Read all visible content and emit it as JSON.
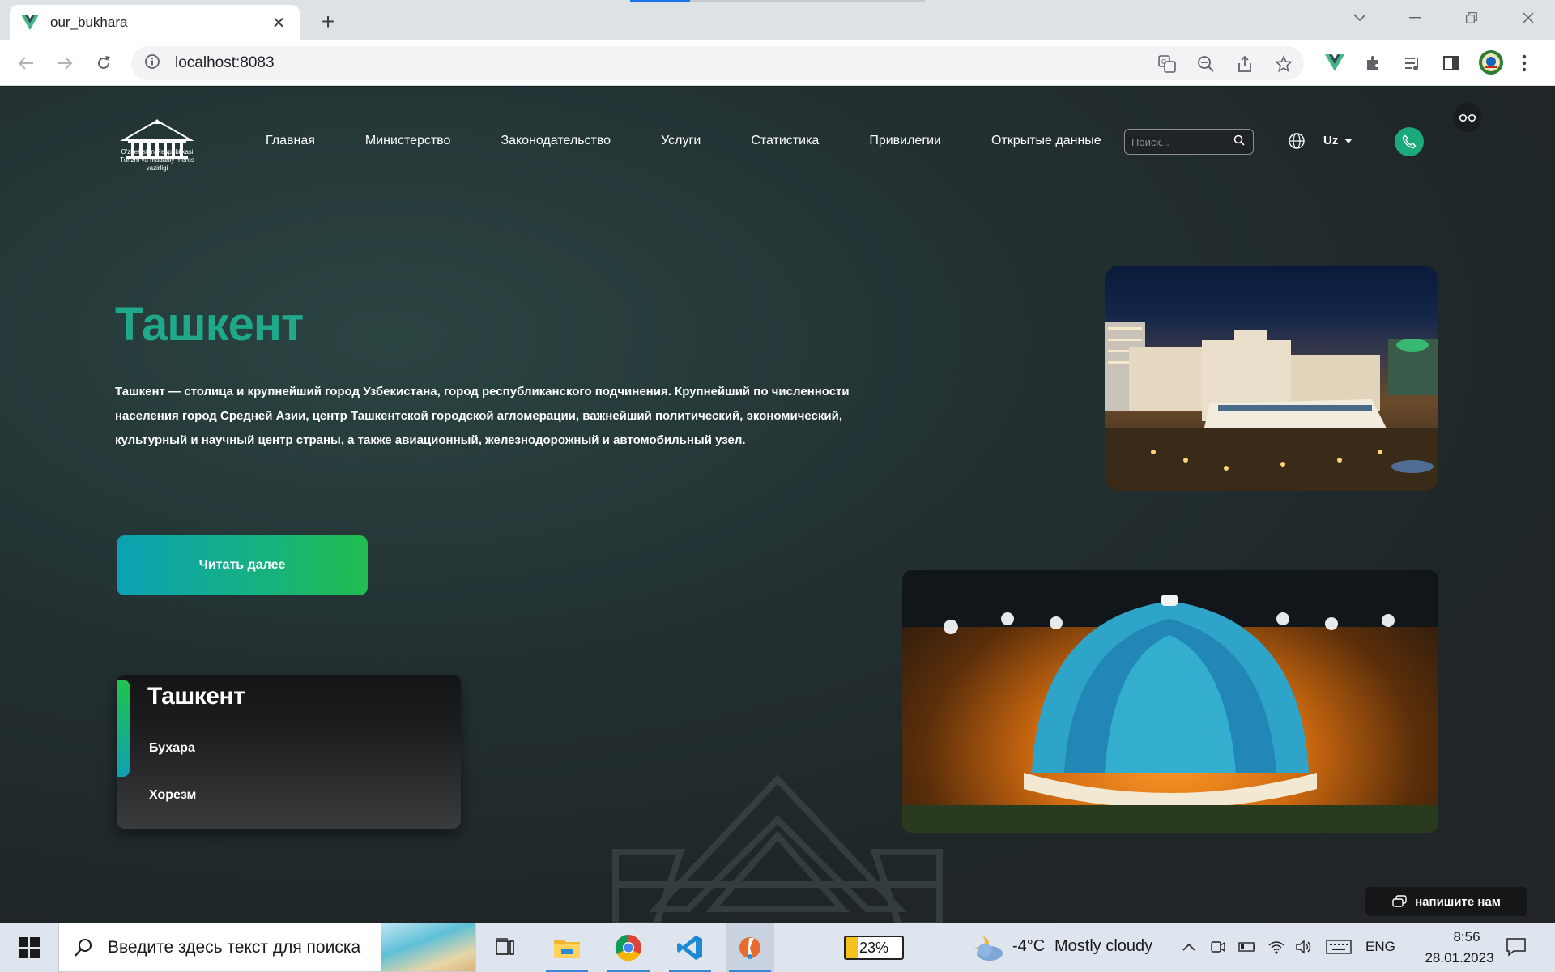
{
  "browser": {
    "tab_title": "our_bukhara",
    "new_tab_label": "+",
    "close_label": "✕",
    "url": "localhost:8083"
  },
  "site": {
    "logo_line1": "O'zbekiston Respublikasi",
    "logo_line2": "Turizm va madaniy meros",
    "logo_line3": "vazirligi",
    "menu": [
      "Главная",
      "Министерство",
      "Законодательство",
      "Услуги",
      "Статистика",
      "Привилегии",
      "Открытые данные"
    ],
    "search_placeholder": "Поиск...",
    "language": "Uz",
    "accent_color": "#1fa98a"
  },
  "hero": {
    "title": "Ташкент",
    "description": "Ташкент — столица и крупнейший город Узбекистана, город республиканского подчинения. Крупнейший по численности населения город Средней Азии, центр Ташкентской городской агломерации, важнейший политический, экономический, культурный и научный центр страны, а также авиационный, железнодорожный и автомобильный узел.",
    "button": "Читать далее"
  },
  "cities": {
    "active": "Ташкент",
    "items": [
      "Бухара",
      "Хорезм"
    ]
  },
  "chat": {
    "label": "напишите нам"
  },
  "taskbar": {
    "search_placeholder": "Введите здесь текст для поиска",
    "battery": "23%",
    "temperature": "-4°C",
    "weather": "Mostly cloudy",
    "language": "ENG",
    "time": "8:56",
    "date": "28.01.2023"
  }
}
